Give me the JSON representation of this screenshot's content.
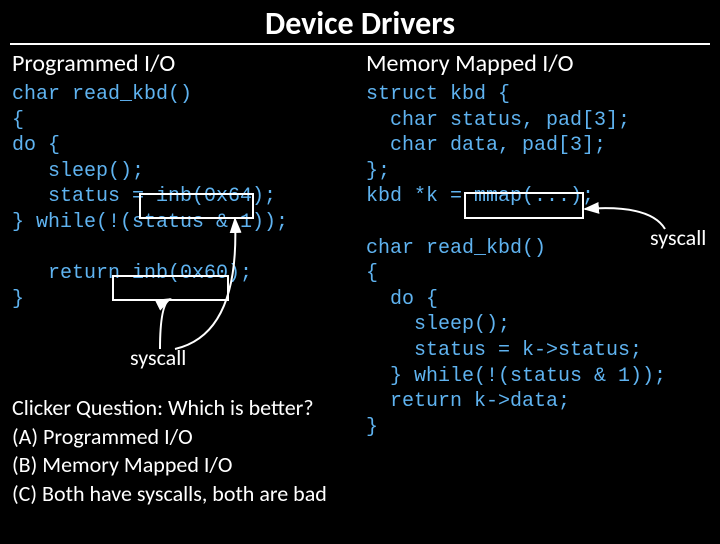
{
  "title": "Device Drivers",
  "left": {
    "heading": "Programmed I/O",
    "code": "char read_kbd()\n{\ndo {\n   sleep();\n   status = inb(0x64);\n} while(!(status & 1));\n\n   return inb(0x60);\n}"
  },
  "right": {
    "heading": "Memory Mapped I/O",
    "code": "struct kbd {\n  char status, pad[3];\n  char data, pad[3];\n};\nkbd *k = mmap(...);\n\nchar read_kbd()\n{\n  do {\n    sleep();\n    status = k->status;\n  } while(!(status & 1));\n  return k->data;\n}"
  },
  "labels": {
    "syscall_left": "syscall",
    "syscall_right": "syscall"
  },
  "question": {
    "line1": "Clicker Question: Which is better?",
    "line2": "(A) Programmed I/O",
    "line3": "(B) Memory Mapped I/O",
    "line4": "(C) Both have syscalls, both are bad"
  }
}
